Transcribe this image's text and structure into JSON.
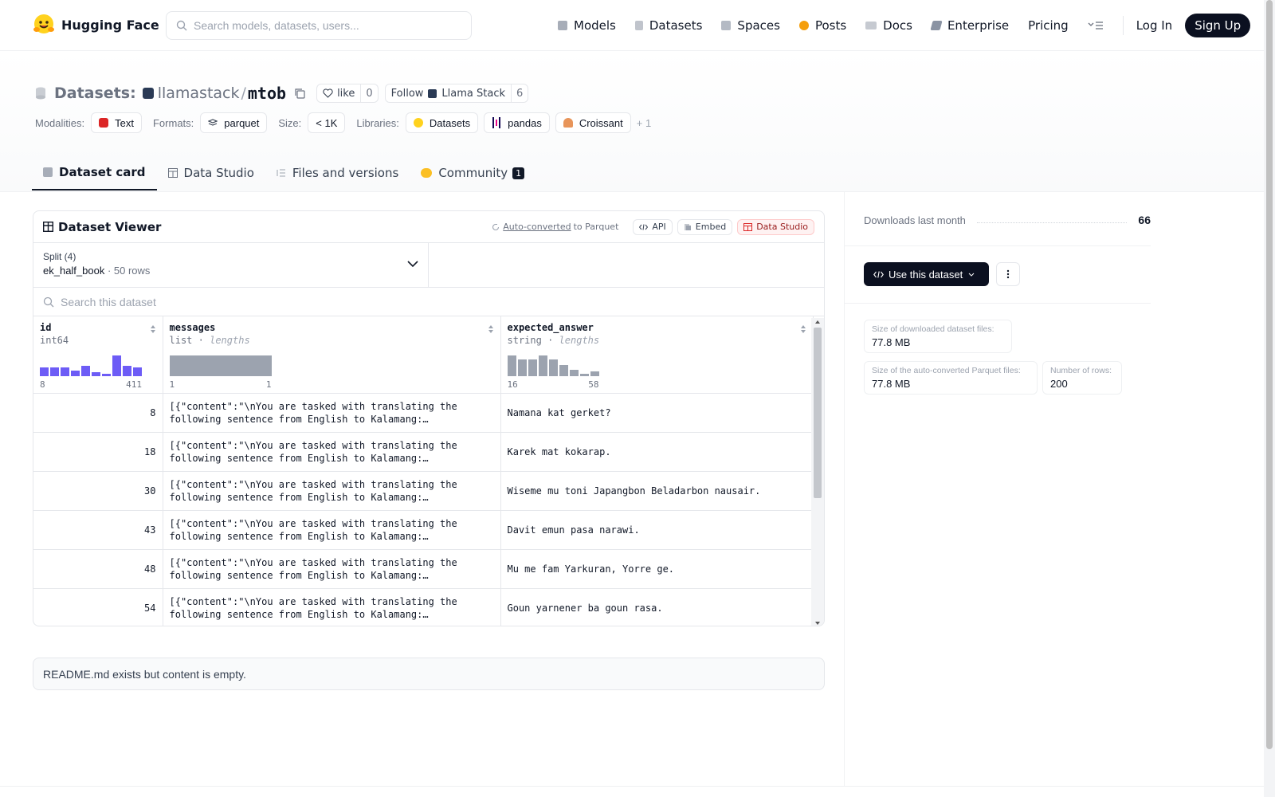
{
  "header": {
    "logo_text": "Hugging Face",
    "search_placeholder": "Search models, datasets, users...",
    "nav": [
      "Models",
      "Datasets",
      "Spaces",
      "Posts",
      "Docs",
      "Enterprise",
      "Pricing"
    ],
    "login": "Log In",
    "signup": "Sign Up"
  },
  "title": {
    "section": "Datasets:",
    "org": "llamastack",
    "slash": "/",
    "name": "mtob",
    "like_label": "like",
    "like_count": "0",
    "follow_label": "Follow",
    "follow_org": "Llama Stack",
    "follow_count": "6"
  },
  "tags": {
    "modalities_label": "Modalities:",
    "modalities": "Text",
    "formats_label": "Formats:",
    "formats": "parquet",
    "size_label": "Size:",
    "size": "< 1K",
    "libraries_label": "Libraries:",
    "libraries": [
      "Datasets",
      "pandas",
      "Croissant"
    ],
    "more": "+ 1"
  },
  "tabs": [
    {
      "label": "Dataset card"
    },
    {
      "label": "Data Studio"
    },
    {
      "label": "Files and versions"
    },
    {
      "label": "Community",
      "badge": "1"
    }
  ],
  "viewer": {
    "title": "Dataset Viewer",
    "auto_converted": "Auto-converted",
    "to_parquet": "to Parquet",
    "api": "API",
    "embed": "Embed",
    "data_studio": "Data Studio",
    "split_label": "Split (4)",
    "split_value": "ek_half_book",
    "split_rows": "50 rows",
    "search_placeholder": "Search this dataset",
    "columns": [
      {
        "name": "id",
        "type": "int64",
        "range_min": "8",
        "range_max": "411",
        "hist": [
          0.42,
          0.42,
          0.42,
          0.28,
          0.5,
          0.18,
          0.1,
          1.0,
          0.5,
          0.42
        ],
        "hist_color": "#6d5cf6"
      },
      {
        "name": "messages",
        "type": "list",
        "sub": "lengths",
        "range_min": "1",
        "range_max": "1",
        "hist": [
          1.0
        ],
        "hist_color": "#9ca3af"
      },
      {
        "name": "expected_answer",
        "type": "string",
        "sub": "lengths",
        "range_min": "16",
        "range_max": "58",
        "hist": [
          1.0,
          0.8,
          0.8,
          1.0,
          0.8,
          0.55,
          0.3,
          0.12,
          0.22
        ],
        "hist_color": "#9ca3af"
      }
    ],
    "rows": [
      {
        "id": "8",
        "messages": "[{\"content\":\"\\nYou are tasked with translating the following sentence from English to Kalamang:…",
        "expected": "Namana kat gerket?"
      },
      {
        "id": "18",
        "messages": "[{\"content\":\"\\nYou are tasked with translating the following sentence from English to Kalamang:…",
        "expected": "Karek mat kokarap."
      },
      {
        "id": "30",
        "messages": "[{\"content\":\"\\nYou are tasked with translating the following sentence from English to Kalamang:…",
        "expected": "Wiseme mu toni Japangbon Beladarbon nausair."
      },
      {
        "id": "43",
        "messages": "[{\"content\":\"\\nYou are tasked with translating the following sentence from English to Kalamang:…",
        "expected": "Davit emun pasa narawi."
      },
      {
        "id": "48",
        "messages": "[{\"content\":\"\\nYou are tasked with translating the following sentence from English to Kalamang:…",
        "expected": "Mu me fam Yarkuran, Yorre ge."
      },
      {
        "id": "54",
        "messages": "[{\"content\":\"\\nYou are tasked with translating the following sentence from English to Kalamang:…",
        "expected": "Goun yarnener ba goun rasa."
      }
    ]
  },
  "readme": "README.md exists but content is empty.",
  "sidebar": {
    "downloads_label": "Downloads last month",
    "downloads_value": "66",
    "use_button": "Use this dataset",
    "size_downloaded_label": "Size of downloaded dataset files:",
    "size_downloaded": "77.8 MB",
    "size_parquet_label": "Size of the auto-converted Parquet files:",
    "size_parquet": "77.8 MB",
    "rows_label": "Number of rows:",
    "rows_value": "200"
  },
  "colors": {
    "primary_dark": "#0b1020",
    "histogram_id": "#6d5cf6",
    "histogram_gray": "#9ca3af"
  }
}
